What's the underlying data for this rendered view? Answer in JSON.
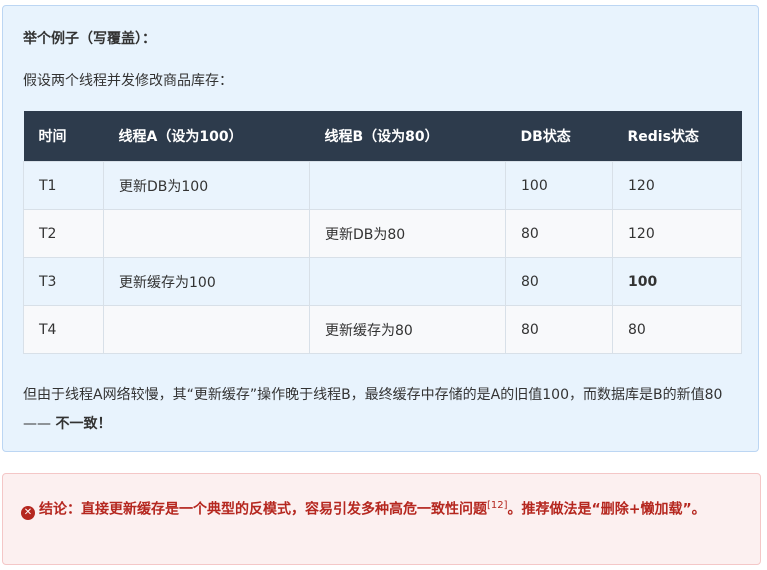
{
  "example_title": "举个例子（写覆盖）：",
  "intro": "假设两个线程并发修改商品库存：",
  "table": {
    "headers": [
      "时间",
      "线程A（设为100）",
      "线程B（设为80）",
      "DB状态",
      "Redis状态"
    ],
    "rows": [
      [
        "T1",
        "更新DB为100",
        "",
        "100",
        "120"
      ],
      [
        "T2",
        "",
        "更新DB为80",
        "80",
        "120"
      ],
      [
        "T3",
        "更新缓存为100",
        "",
        "80",
        "100"
      ],
      [
        "T4",
        "",
        "更新缓存为80",
        "80",
        "80"
      ]
    ]
  },
  "paragraph": "但由于线程A网络较慢，其“更新缓存”操作晚于线程B，最终缓存中存储的是A的旧值100，而数据库是B的新值80 —— ",
  "paragraph_bold": "不一致！",
  "alert": {
    "icon": "x-circle-icon",
    "text": "结论：直接更新缓存是一个典型的反模式，容易引发多种高危一致性问题",
    "ref": "[12]",
    "text2": "。推荐做法是“删除+懒加载”。"
  }
}
